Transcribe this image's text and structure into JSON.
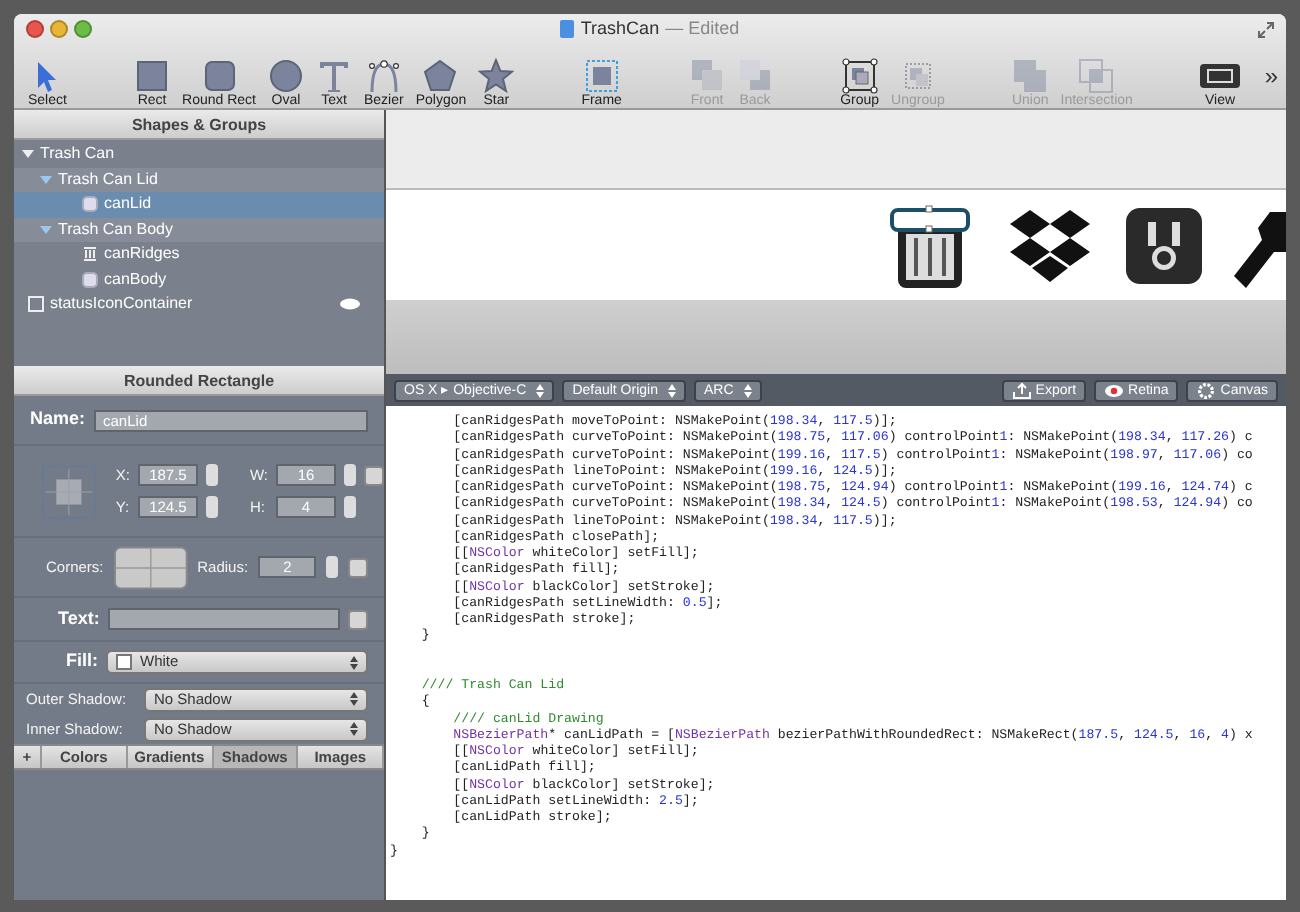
{
  "window": {
    "title": "TrashCan",
    "subtitle": "— Edited"
  },
  "toolbar": [
    [
      {
        "label": "Select",
        "kind": "select",
        "disabled": false
      }
    ],
    [
      {
        "label": "Rect",
        "kind": "rect",
        "disabled": false
      },
      {
        "label": "Round Rect",
        "kind": "roundrect",
        "disabled": false
      },
      {
        "label": "Oval",
        "kind": "oval",
        "disabled": false
      },
      {
        "label": "Text",
        "kind": "text",
        "disabled": false
      },
      {
        "label": "Bezier",
        "kind": "bezier",
        "disabled": false
      },
      {
        "label": "Polygon",
        "kind": "polygon",
        "disabled": false
      },
      {
        "label": "Star",
        "kind": "star",
        "disabled": false
      }
    ],
    [
      {
        "label": "Frame",
        "kind": "frame",
        "disabled": false
      }
    ],
    [
      {
        "label": "Front",
        "kind": "front",
        "disabled": true
      },
      {
        "label": "Back",
        "kind": "back",
        "disabled": true
      }
    ],
    [
      {
        "label": "Group",
        "kind": "group",
        "disabled": false
      },
      {
        "label": "Ungroup",
        "kind": "ungroup",
        "disabled": true
      }
    ],
    [
      {
        "label": "Union",
        "kind": "union",
        "disabled": true
      },
      {
        "label": "Intersection",
        "kind": "intersection",
        "disabled": true
      }
    ],
    [
      {
        "label": "View",
        "kind": "view",
        "disabled": false
      }
    ]
  ],
  "toolbar_overflow": "»",
  "shapes_panel": {
    "title": "Shapes & Groups",
    "items": [
      {
        "label": "Trash Can",
        "kind": "group",
        "expanded": true,
        "selected": false,
        "children": [
          {
            "label": "Trash Can Lid",
            "kind": "group",
            "expanded": true,
            "selected": false,
            "children": [
              {
                "label": "canLid",
                "kind": "shape",
                "selected": true
              }
            ]
          },
          {
            "label": "Trash Can Body",
            "kind": "group",
            "expanded": true,
            "selected": false,
            "children": [
              {
                "label": "canRidges",
                "kind": "ridges",
                "selected": false
              },
              {
                "label": "canBody",
                "kind": "shape",
                "selected": false
              }
            ]
          }
        ]
      },
      {
        "label": "statusIconContainer",
        "kind": "frame",
        "selected": false,
        "eye": true
      }
    ]
  },
  "inspector": {
    "title": "Rounded Rectangle",
    "name_label": "Name:",
    "name_value": "canLid",
    "fields": [
      {
        "label": "X:",
        "value": "187.5"
      },
      {
        "label": "W:",
        "value": "16"
      },
      {
        "label": "Y:",
        "value": "124.5"
      },
      {
        "label": "H:",
        "value": "4"
      }
    ],
    "corners_label": "Corners:",
    "radius_label": "Radius:",
    "radius_value": "2",
    "text_label": "Text:",
    "fill_label": "Fill:",
    "fill_value": "White",
    "outer_shadow_label": "Outer Shadow:",
    "outer_shadow_value": "No Shadow",
    "inner_shadow_label": "Inner Shadow:",
    "inner_shadow_value": "No Shadow"
  },
  "library_tabs": [
    {
      "label": "+",
      "selected": false
    },
    {
      "label": "Colors",
      "selected": false
    },
    {
      "label": "Gradients",
      "selected": false
    },
    {
      "label": "Shadows",
      "selected": true
    },
    {
      "label": "Images",
      "selected": false
    }
  ],
  "code_toolbar": {
    "dropdowns": [
      "OS X ▸ Objective-C",
      "Default Origin",
      "ARC"
    ],
    "buttons": [
      {
        "label": "Export",
        "kind": "export"
      },
      {
        "label": "Retina",
        "kind": "retina"
      },
      {
        "label": "Canvas",
        "kind": "canvas"
      }
    ]
  },
  "code_lines": [
    {
      "kind": "code",
      "text": "        [canRidgesPath moveToPoint: NSMakePoint(198.34, 117.5)];"
    },
    {
      "kind": "code",
      "text": "        [canRidgesPath curveToPoint: NSMakePoint(198.75, 117.06) controlPoint1: NSMakePoint(198.34, 117.26) c"
    },
    {
      "kind": "code",
      "text": "        [canRidgesPath curveToPoint: NSMakePoint(199.16, 117.5) controlPoint1: NSMakePoint(198.97, 117.06) co"
    },
    {
      "kind": "code",
      "text": "        [canRidgesPath lineToPoint: NSMakePoint(199.16, 124.5)];"
    },
    {
      "kind": "code",
      "text": "        [canRidgesPath curveToPoint: NSMakePoint(198.75, 124.94) controlPoint1: NSMakePoint(199.16, 124.74) c"
    },
    {
      "kind": "code",
      "text": "        [canRidgesPath curveToPoint: NSMakePoint(198.34, 124.5) controlPoint1: NSMakePoint(198.53, 124.94) co"
    },
    {
      "kind": "code",
      "text": "        [canRidgesPath lineToPoint: NSMakePoint(198.34, 117.5)];"
    },
    {
      "kind": "code",
      "text": "        [canRidgesPath closePath];"
    },
    {
      "kind": "code",
      "text": "        [[NSColor whiteColor] setFill];"
    },
    {
      "kind": "code",
      "text": "        [canRidgesPath fill];"
    },
    {
      "kind": "code",
      "text": "        [[NSColor blackColor] setStroke];"
    },
    {
      "kind": "code",
      "text": "        [canRidgesPath setLineWidth: 0.5];"
    },
    {
      "kind": "code",
      "text": "        [canRidgesPath stroke];"
    },
    {
      "kind": "code",
      "text": "    }"
    },
    {
      "kind": "blank"
    },
    {
      "kind": "blank"
    },
    {
      "kind": "comment",
      "text": "    //// Trash Can Lid"
    },
    {
      "kind": "code",
      "text": "    {"
    },
    {
      "kind": "comment",
      "text": "        //// canLid Drawing"
    },
    {
      "kind": "code",
      "text": "        NSBezierPath* canLidPath = [NSBezierPath bezierPathWithRoundedRect: NSMakeRect(187.5, 124.5, 16, 4) x"
    },
    {
      "kind": "code",
      "text": "        [[NSColor whiteColor] setFill];"
    },
    {
      "kind": "code",
      "text": "        [canLidPath fill];"
    },
    {
      "kind": "code",
      "text": "        [[NSColor blackColor] setStroke];"
    },
    {
      "kind": "code",
      "text": "        [canLidPath setLineWidth: 2.5];"
    },
    {
      "kind": "code",
      "text": "        [canLidPath stroke];"
    },
    {
      "kind": "code",
      "text": "    }"
    },
    {
      "kind": "code",
      "text": "}"
    }
  ]
}
